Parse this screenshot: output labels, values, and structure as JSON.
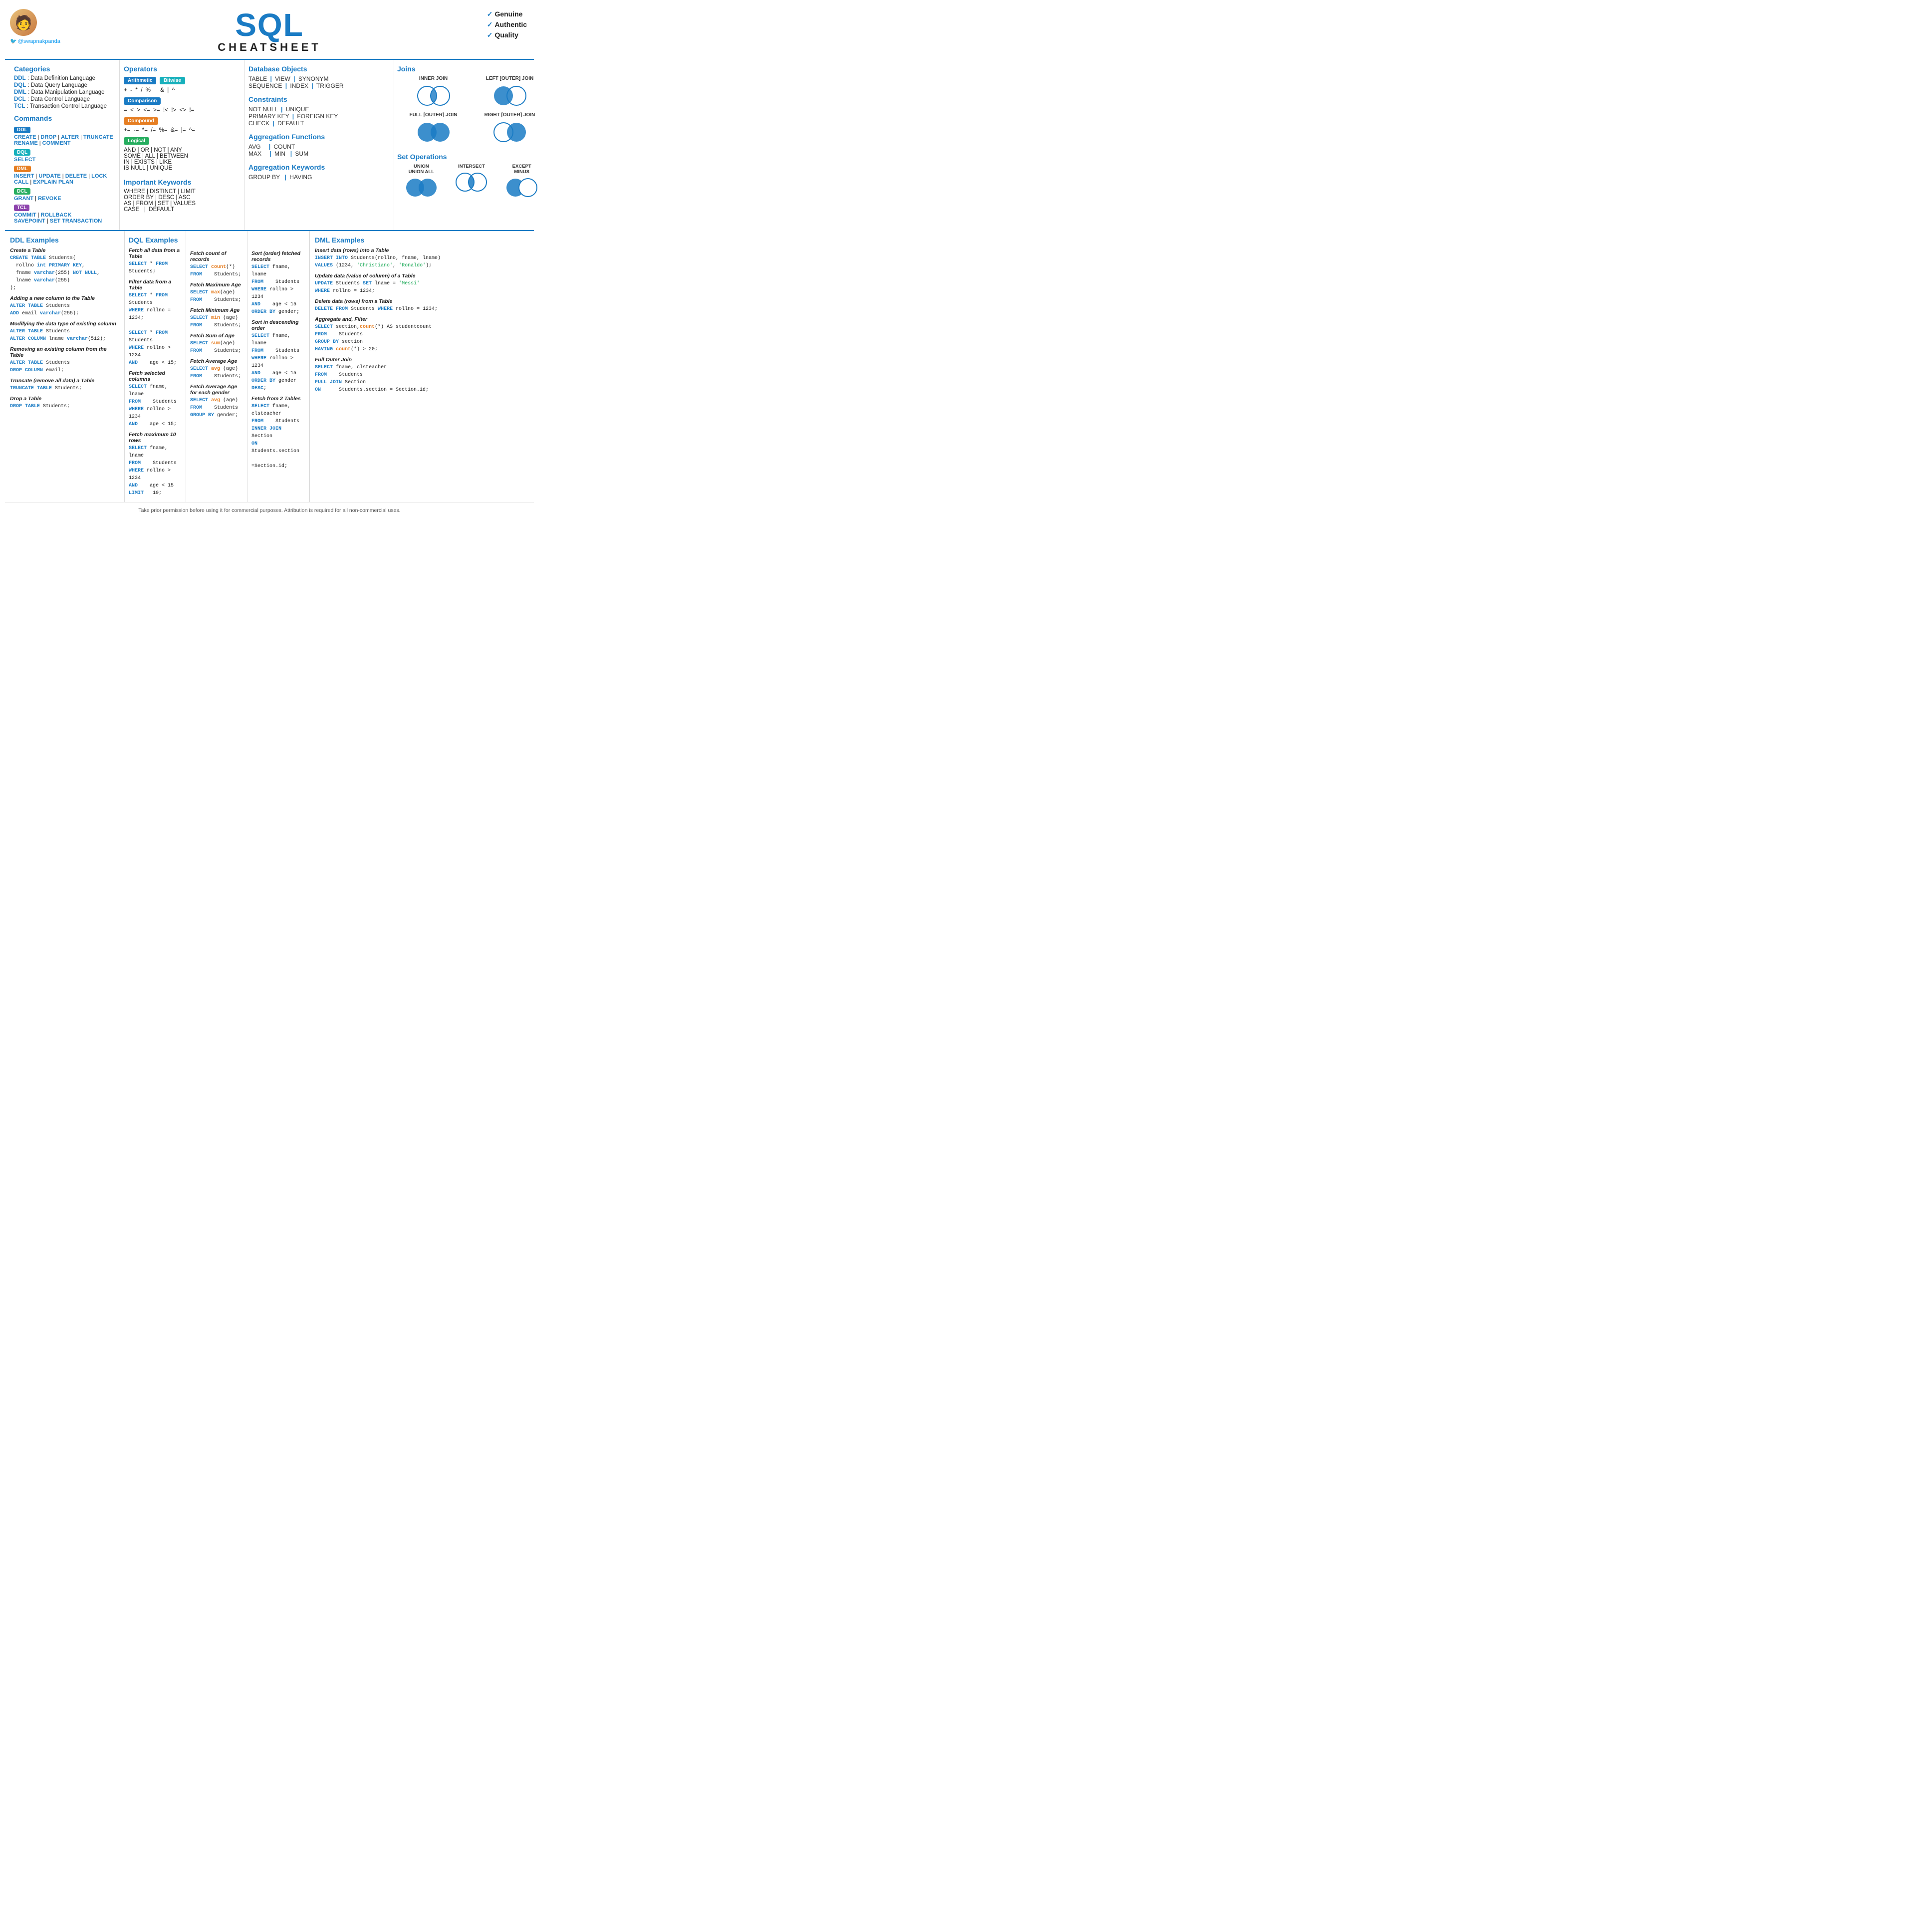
{
  "header": {
    "title_sql": "SQL",
    "title_sub": "CHEATSHEET",
    "twitter": "@swapnakpanda",
    "badges": [
      "✓ Genuine",
      "✓ Authentic",
      "✓ Quality"
    ]
  },
  "categories": {
    "title": "Categories",
    "items": [
      {
        "key": "DDL",
        "desc": ": Data Definition Language"
      },
      {
        "key": "DQL",
        "desc": ": Data Query Language"
      },
      {
        "key": "DML",
        "desc": ": Data Manipulation Language"
      },
      {
        "key": "DCL",
        "desc": ": Data Control Language"
      },
      {
        "key": "TCL",
        "desc": ": Transaction Control Language"
      }
    ]
  },
  "commands": {
    "title": "Commands",
    "groups": [
      {
        "badge": "DDL",
        "items": "CREATE | DROP | ALTER | TRUNCATE\nRENAME | COMMENT"
      },
      {
        "badge": "DQL",
        "items": "SELECT"
      },
      {
        "badge": "DML",
        "items": "INSERT | UPDATE | DELETE | LOCK\nCALL | EXPLAIN PLAN"
      },
      {
        "badge": "DCL",
        "items": "GRANT | REVOKE"
      },
      {
        "badge": "TCL",
        "items": "COMMIT | ROLLBACK\nSAVEPOINT | SET TRANSACTION"
      }
    ]
  },
  "operators": {
    "title": "Operators",
    "groups": [
      {
        "badge": "Arithmetic",
        "type": "arith",
        "text": "+ - * / %"
      },
      {
        "badge": "Bitwise",
        "type": "bitwise",
        "text": "& | ^"
      },
      {
        "badge": "Comparison",
        "type": "comparison",
        "text": "= < > <= >= !< !> <> !="
      },
      {
        "badge": "Compound",
        "type": "compound",
        "text": "+= -= *= /= %= &= |= ^="
      },
      {
        "badge": "Logical",
        "type": "logical",
        "text": "AND | OR | NOT | ANY\nSOME | ALL | BETWEEN\nIN | EXISTS | LIKE\nIS NULL | UNIQUE"
      }
    ]
  },
  "important_keywords": {
    "title": "Important Keywords",
    "text": "WHERE | DISTINCT | LIMIT\nORDER BY | DESC | ASC\nAS | FROM | SET | VALUES\nCASE | DEFAULT"
  },
  "database_objects": {
    "title": "Database Objects",
    "items": [
      "TABLE",
      "VIEW",
      "SYNONYM",
      "SEQUENCE",
      "INDEX",
      "TRIGGER"
    ]
  },
  "constraints": {
    "title": "Constraints",
    "items": [
      "NOT NULL",
      "UNIQUE",
      "PRIMARY KEY",
      "FOREIGN KEY",
      "CHECK",
      "DEFAULT"
    ]
  },
  "agg_functions": {
    "title": "Aggregation Functions",
    "items": [
      "AVG",
      "COUNT",
      "MAX",
      "MIN",
      "SUM"
    ]
  },
  "agg_keywords": {
    "title": "Aggregation Keywords",
    "items": [
      "GROUP BY",
      "HAVING"
    ]
  },
  "joins": {
    "title": "Joins",
    "types": [
      {
        "label": "INNER JOIN",
        "fill": "intersection"
      },
      {
        "label": "LEFT [OUTER] JOIN",
        "fill": "left"
      },
      {
        "label": "FULL [OUTER] JOIN",
        "fill": "both"
      },
      {
        "label": "RIGHT [OUTER] JOIN",
        "fill": "right"
      }
    ]
  },
  "set_operations": {
    "title": "Set Operations",
    "types": [
      {
        "label": "UNION\nUNION ALL",
        "fill": "both"
      },
      {
        "label": "INTERSECT",
        "fill": "intersection"
      },
      {
        "label": "EXCEPT\nMINUS",
        "fill": "left"
      }
    ]
  },
  "ddl_examples": {
    "title": "DDL Examples",
    "examples": [
      {
        "subtitle": "Create a Table",
        "code": "CREATE TABLE Students(\n  rollno int PRIMARY KEY,\n  fname varchar(255) NOT NULL,\n  lname varchar(255)\n);"
      },
      {
        "subtitle": "Adding a new column to the Table",
        "code": "ALTER TABLE Students\nADD email varchar(255);"
      },
      {
        "subtitle": "Modifying the data type of existing column",
        "code": "ALTER TABLE Students\nALTER COLUMN lname varchar(512);"
      },
      {
        "subtitle": "Removing an existing column from the Table",
        "code": "ALTER TABLE Students\nDROP COLUMN email;"
      },
      {
        "subtitle": "Truncate (remove all data) a Table",
        "code": "TRUNCATE TABLE Students;"
      },
      {
        "subtitle": "Drop a Table",
        "code": "DROP TABLE Students;"
      }
    ]
  },
  "dql_examples": {
    "title": "DQL Examples",
    "examples": [
      {
        "subtitle": "Fetch all data from a Table",
        "code": "SELECT * FROM Students;"
      },
      {
        "subtitle": "Filter data from a Table",
        "code": "SELECT * FROM Students\nWHERE rollno = 1234;\n\nSELECT * FROM Students\nWHERE rollno > 1234\nAND   age < 15;"
      },
      {
        "subtitle": "Fetch selected columns",
        "code": "SELECT fname, lname\nFROM   Students\nWHERE rollno > 1234\nAND   age < 15;"
      },
      {
        "subtitle": "Fetch maximum 10 rows",
        "code": "SELECT fname, lname\nFROM   Students\nWHERE rollno > 1234\nAND   age < 15\nLIMIT  10;"
      }
    ],
    "examples2": [
      {
        "subtitle": "Fetch count of records",
        "code": "SELECT count(*)\nFROM   Students;"
      },
      {
        "subtitle": "Fetch Maximum Age",
        "code": "SELECT max(age)\nFROM   Students;"
      },
      {
        "subtitle": "Fetch Minimum Age",
        "code": "SELECT min (age)\nFROM   Students;"
      },
      {
        "subtitle": "Fetch Sum of Age",
        "code": "SELECT sum(age)\nFROM   Students;"
      },
      {
        "subtitle": "Fetch Average Age",
        "code": "SELECT avg (age)\nFROM   Students;"
      },
      {
        "subtitle": "Fetch Average Age for each gender",
        "code": "SELECT avg (age)\nFROM   Students\nGROUP BY gender;"
      }
    ],
    "examples3": [
      {
        "subtitle": "Sort (order) fetched records",
        "code": "SELECT fname, lname\nFROM   Students\nWHERE rollno > 1234\nAND   age < 15\nORDER BY gender;"
      },
      {
        "subtitle": "Sort in descending order",
        "code": "SELECT fname, lname\nFROM   Students\nWHERE rollno > 1234\nAND   age < 15\nORDER BY gender DESC;"
      },
      {
        "subtitle": "Fetch from 2 Tables",
        "code": "SELECT fname, clsteacher\nFROM   Students\nINNER JOIN Section\nON     Students.section\n       =Section.id;"
      }
    ]
  },
  "dml_examples": {
    "title": "DML Examples",
    "examples": [
      {
        "subtitle": "Insert data (rows) into a Table",
        "code": "INSERT INTO Students(rollno, fname, lname)\nVALUES (1234, 'Christiano', 'Ronaldo');"
      },
      {
        "subtitle": "Update data (value of column) of a Table",
        "code": "UPDATE Students SET lname = 'Messi'\nWHERE rollno = 1234;"
      },
      {
        "subtitle": "Delete data (rows) from a Table",
        "code": "DELETE FROM Students WHERE rollno = 1234;"
      },
      {
        "subtitle": "Aggregate and, Filter",
        "code": "SELECT section,count(*) AS studentcount\nFROM   Students\nGROUP BY section\nHAVING count(*) > 20;"
      },
      {
        "subtitle": "Full Outer Join",
        "code": "SELECT fname, clsteacher\nFROM   Students\nFULL JOIN Section\nON     Students.section = Section.id;"
      }
    ]
  },
  "footer": {
    "text": "Take prior permission before using it for commercial purposes. Attribution is required for all non-commercial uses."
  }
}
